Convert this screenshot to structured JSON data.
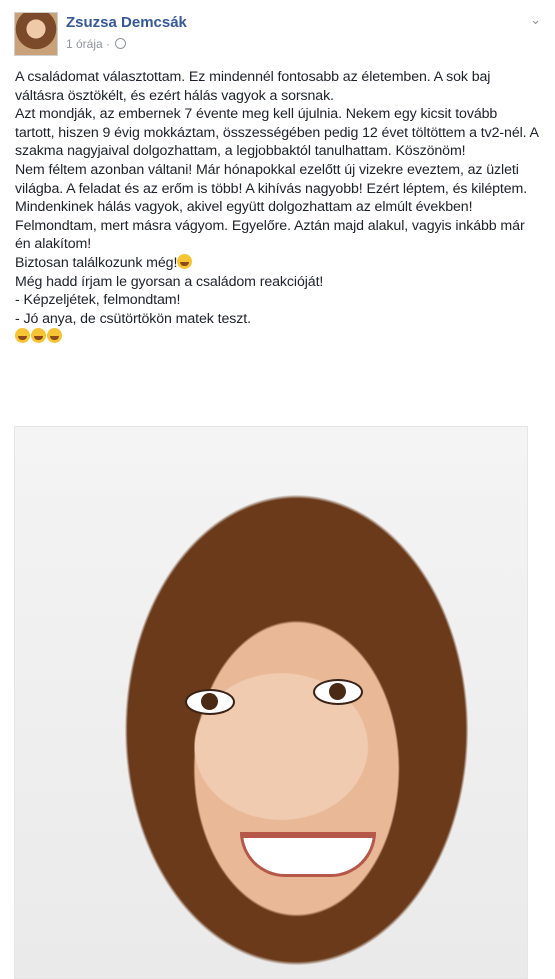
{
  "post": {
    "author": "Zsuzsa Demcsák",
    "time": "1 órája",
    "text": "A családomat választottam. Ez mindennél fontosabb az életemben. A sok baj váltásra ösztökélt, és ezért hálás vagyok a sorsnak.\nAzt mondják, az embernek 7 évente meg kell újulnia. Nekem egy kicsit tovább tartott, hiszen 9 évig mokkáztam, összességében pedig 12 évet töltöttem a tv2-nél. A szakma nagyjaival dolgozhattam, a legjobbaktól tanulhattam. Köszönöm!\nNem féltem azonban váltani! Már hónapokkal ezelőtt új vizekre eveztem, az üzleti világba. A feladat és az erőm is több! A kihívás nagyobb! Ezért léptem, és kiléptem.\nMindenkinek hálás vagyok, akivel együtt dolgozhattam az elmúlt években! Felmondtam, mert másra vágyom. Egyelőre. Aztán majd alakul, vagyis inkább már én alakítom!\nBiztosan találkozunk még!",
    "text2": "Még hadd írjam le gyorsan a családom reakcióját!\n- Képzeljétek, felmondtam!\n- Jó anya, de csütörtökön matek teszt.",
    "options_icon": "chevron-down-icon",
    "privacy_icon": "globe-icon"
  }
}
